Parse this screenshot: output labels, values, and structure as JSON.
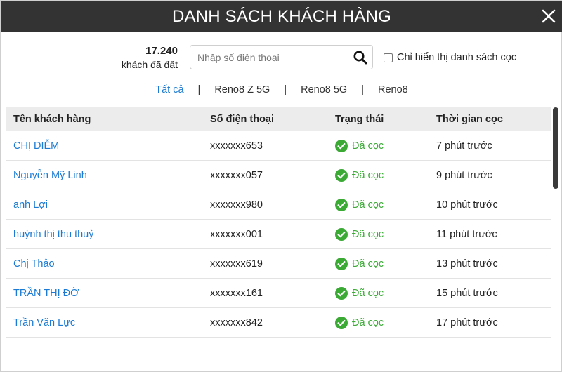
{
  "header": {
    "title": "DANH SÁCH KHÁCH HÀNG",
    "close_icon": "close-icon"
  },
  "summary": {
    "count": "17.240",
    "count_label": "khách đã đặt"
  },
  "search": {
    "placeholder": "Nhập số điện thoại",
    "value": "",
    "icon": "search-icon"
  },
  "filter": {
    "label": "Chỉ hiển thị danh sách cọc",
    "checked": false
  },
  "tabs": [
    {
      "label": "Tất cả",
      "active": true
    },
    {
      "label": "Reno8 Z 5G",
      "active": false
    },
    {
      "label": "Reno8 5G",
      "active": false
    },
    {
      "label": "Reno8",
      "active": false
    }
  ],
  "table": {
    "headers": [
      "Tên khách hàng",
      "Số điện thoại",
      "Trạng thái",
      "Thời gian cọc"
    ],
    "rows": [
      {
        "name": "CHỊ DIỄM",
        "phone": "xxxxxxx653",
        "status": "Đã cọc",
        "time": "7 phút trước"
      },
      {
        "name": "Nguyễn Mỹ Linh",
        "phone": "xxxxxxx057",
        "status": "Đã cọc",
        "time": "9 phút trước"
      },
      {
        "name": "anh Lợi",
        "phone": "xxxxxxx980",
        "status": "Đã cọc",
        "time": "10 phút trước"
      },
      {
        "name": "huỳnh thị thu thuỷ",
        "phone": "xxxxxxx001",
        "status": "Đã cọc",
        "time": "11 phút trước"
      },
      {
        "name": "Chị Thảo",
        "phone": "xxxxxxx619",
        "status": "Đã cọc",
        "time": "13 phút trước"
      },
      {
        "name": "TRẦN THỊ ĐỜ",
        "phone": "xxxxxxx161",
        "status": "Đã cọc",
        "time": "15 phút trước"
      },
      {
        "name": "Trần Văn Lực",
        "phone": "xxxxxxx842",
        "status": "Đã cọc",
        "time": "17 phút trước"
      }
    ]
  },
  "colors": {
    "header_bg": "#333333",
    "accent": "#1a7ad4",
    "status_green": "#3aaa35",
    "table_head_bg": "#ececec"
  }
}
